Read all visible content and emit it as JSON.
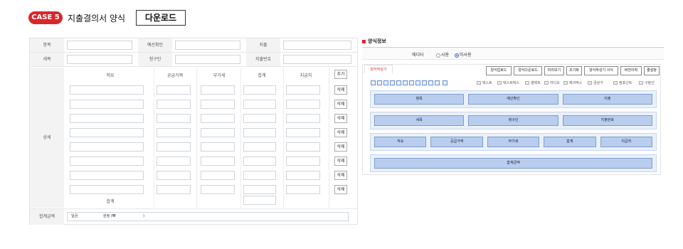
{
  "header": {
    "case_label": "CASE 5",
    "title": "지출결의서 양식",
    "download_label": "다운로드"
  },
  "form": {
    "row1": {
      "label_a": "항목",
      "label_b": "예산확인",
      "label_c": "지출"
    },
    "row2": {
      "label_a": "세목",
      "label_b": "청구인",
      "label_c": "지출번호"
    },
    "detail_label": "상세",
    "columns": [
      "적요",
      "공급가액",
      "부가세",
      "합계",
      "지급처"
    ],
    "add_label": "추가",
    "delete_label": "삭제",
    "rows": 8,
    "sum_label": "합계",
    "total_label": "합계금액",
    "total_text_a": "일금",
    "total_text_b": "원정 (₩",
    "total_text_c": ")"
  },
  "panel": {
    "title": "양식정보",
    "editor_label": "에디터",
    "radio_on": "사용",
    "radio_off": "미사용",
    "tab_label": "양식작성기",
    "buttons": [
      "양식업로드",
      "양식다운로드",
      "미리보기",
      "초기화",
      "양식작성기 서식",
      "버전이력",
      "줄설정"
    ],
    "legend": [
      "텍스트",
      "텍스트박스",
      "셀렉트",
      "라디오",
      "체크박스",
      "금상가",
      "컴포넌트",
      "구분선"
    ],
    "groups": [
      {
        "fields": [
          "항목",
          "예산확인",
          "지출"
        ]
      },
      {
        "fields": [
          "세목",
          "청구인",
          "지출번호"
        ]
      },
      {
        "fields": [
          "적요",
          "공급가액",
          "부가세",
          "합계",
          "지급처"
        ]
      },
      {
        "fields": [
          "합계금액"
        ]
      }
    ]
  },
  "colors": {
    "accent": "#d9262c",
    "field_fill": "#b9cdee",
    "group_fill": "#eaf1fb"
  }
}
